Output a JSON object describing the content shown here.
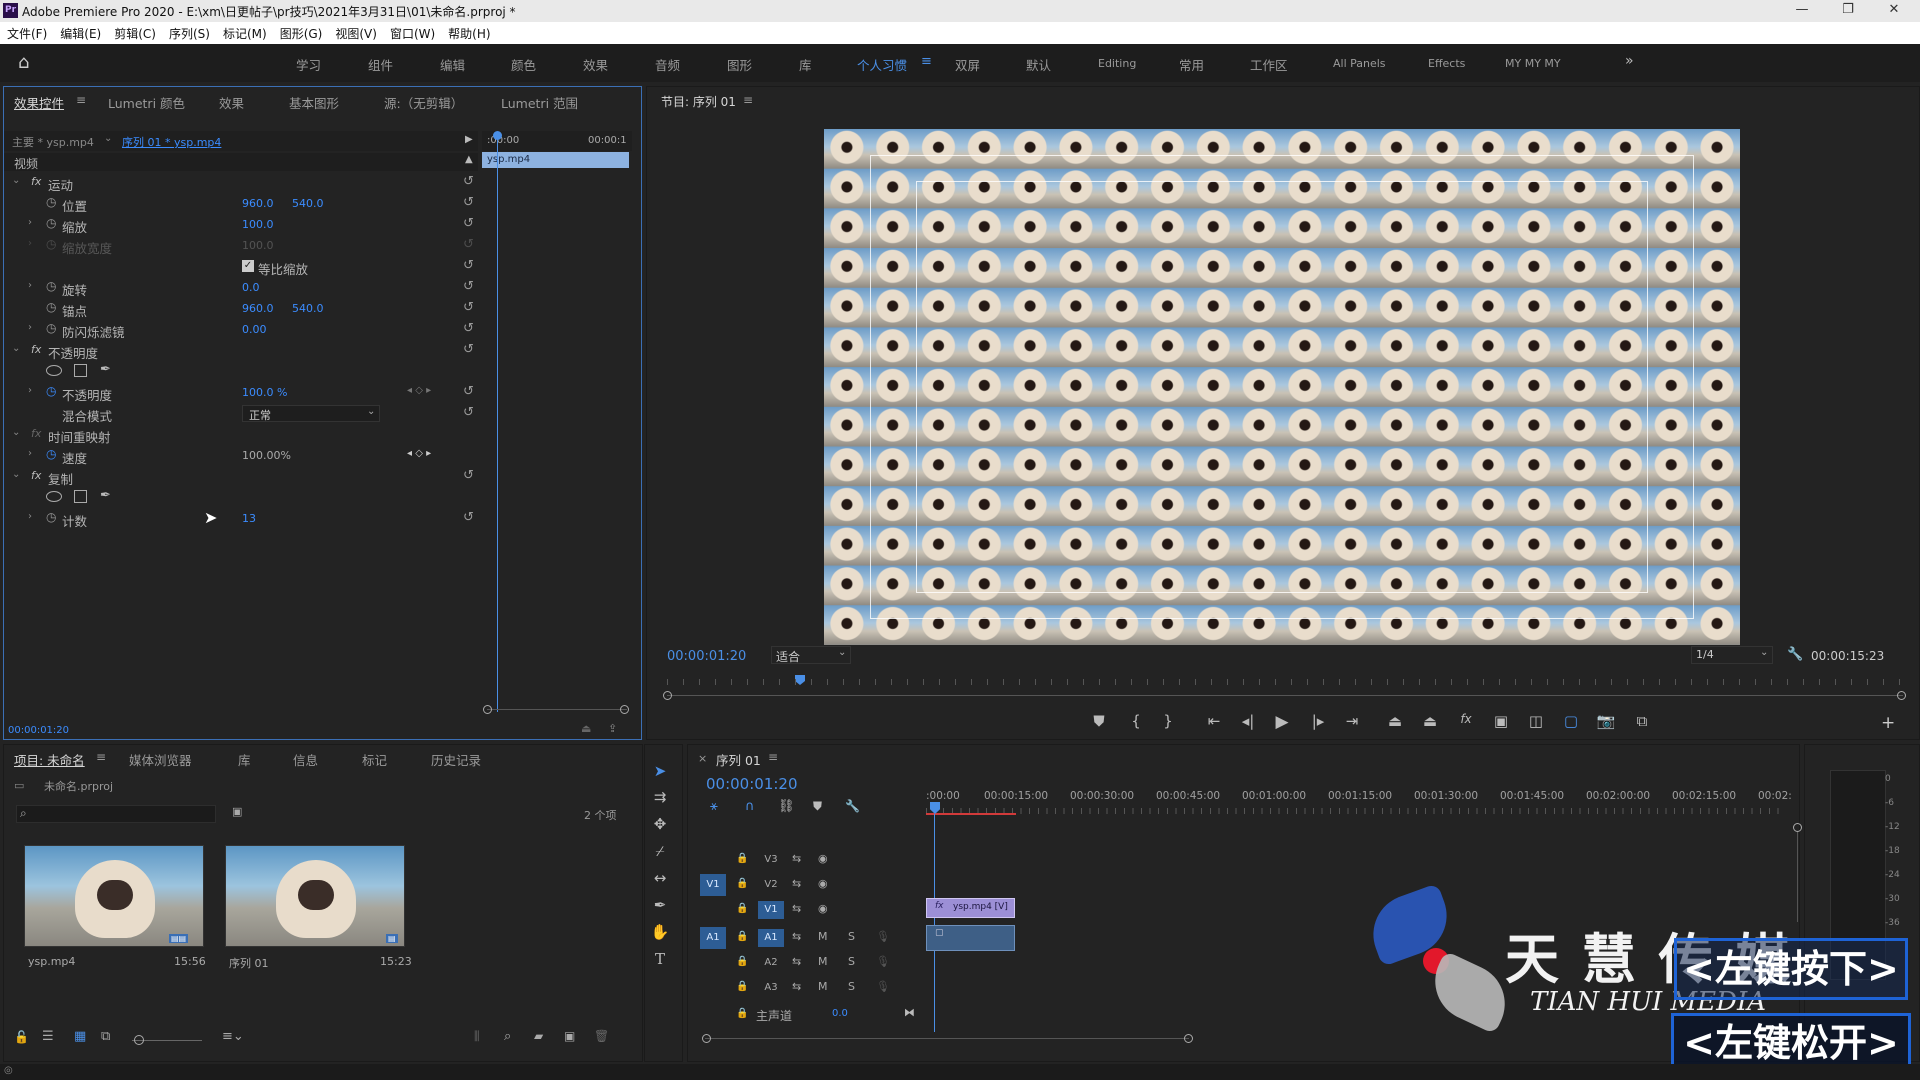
{
  "window": {
    "title": "Adobe Premiere Pro 2020 - E:\\xm\\日更帖子\\pr技巧\\2021年3月31日\\01\\未命名.prproj *",
    "logo": "Pr"
  },
  "menu": [
    "文件(F)",
    "编辑(E)",
    "剪辑(C)",
    "序列(S)",
    "标记(M)",
    "图形(G)",
    "视图(V)",
    "窗口(W)",
    "帮助(H)"
  ],
  "workspaces": [
    "学习",
    "组件",
    "编辑",
    "颜色",
    "效果",
    "音频",
    "图形",
    "库",
    "个人习惯",
    "双屏",
    "默认",
    "Editing",
    "常用",
    "工作区",
    "All Panels",
    "Effects",
    "MY MY MY"
  ],
  "workspaces_active": "个人习惯",
  "effect_tabs": [
    "效果控件",
    "Lumetri 颜色",
    "效果",
    "基本图形",
    "源:（无剪辑）",
    "Lumetri 范围"
  ],
  "effect_ctrl": {
    "master": "主要 * ysp.mp4",
    "seq": "序列 01 * ysp.mp4",
    "video": "视频",
    "ruler_start": ":00:00",
    "ruler_end": "00:00:1",
    "clip": "ysp.mp4",
    "motion": "运动",
    "position": "位置",
    "pos_x": "960.0",
    "pos_y": "540.0",
    "scale": "缩放",
    "scale_v": "100.0",
    "scale_w": "缩放宽度",
    "scale_w_v": "100.0",
    "uniform": "等比缩放",
    "rotation": "旋转",
    "rotation_v": "0.0",
    "anchor": "锚点",
    "anchor_x": "960.0",
    "anchor_y": "540.0",
    "flicker": "防闪烁滤镜",
    "flicker_v": "0.00",
    "opacity_grp": "不透明度",
    "opacity": "不透明度",
    "opacity_v": "100.0 %",
    "blend": "混合模式",
    "blend_v": "正常",
    "timeremap": "时间重映射",
    "speed": "速度",
    "speed_v": "100.00%",
    "replicate": "复制",
    "count": "计数",
    "count_v": "13",
    "timecode": "00:00:01:20"
  },
  "program": {
    "title": "节目: 序列 01",
    "timecode": "00:00:01:20",
    "fit": "适合",
    "quality": "1/4",
    "duration": "00:00:15:23"
  },
  "project_tabs": [
    "项目: 未命名",
    "媒体浏览器",
    "库",
    "信息",
    "标记",
    "历史记录"
  ],
  "project": {
    "file": "未命名.prproj",
    "count": "2 个项",
    "items": [
      {
        "name": "ysp.mp4",
        "dur": "15:56"
      },
      {
        "name": "序列 01",
        "dur": "15:23"
      }
    ]
  },
  "timeline": {
    "tab": "序列 01",
    "timecode": "00:00:01:20",
    "ruler": [
      ":00:00",
      "00:00:15:00",
      "00:00:30:00",
      "00:00:45:00",
      "00:01:00:00",
      "00:01:15:00",
      "00:01:30:00",
      "00:01:45:00",
      "00:02:00:00",
      "00:02:15:00",
      "00:02:"
    ],
    "tracks": [
      "V3",
      "V2",
      "V1",
      "A1",
      "A2",
      "A3"
    ],
    "master": "主声道",
    "master_v": "0.0",
    "clip_v": "ysp.mp4 [V]",
    "src_v": "V1",
    "src_a": "A1"
  },
  "meter": [
    "0",
    "-6",
    "-12",
    "-18",
    "-24",
    "-30",
    "-36"
  ],
  "watermark": {
    "cn": "天 慧 传 媒",
    "en": "TIAN HUI MEDIA"
  },
  "overlay": {
    "down": "<左键按下>",
    "up": "<左键松开>"
  },
  "colors": {
    "accent": "#3b8cff",
    "playhead": "#4a8fe6",
    "clip_v": "#9c8fd6"
  }
}
